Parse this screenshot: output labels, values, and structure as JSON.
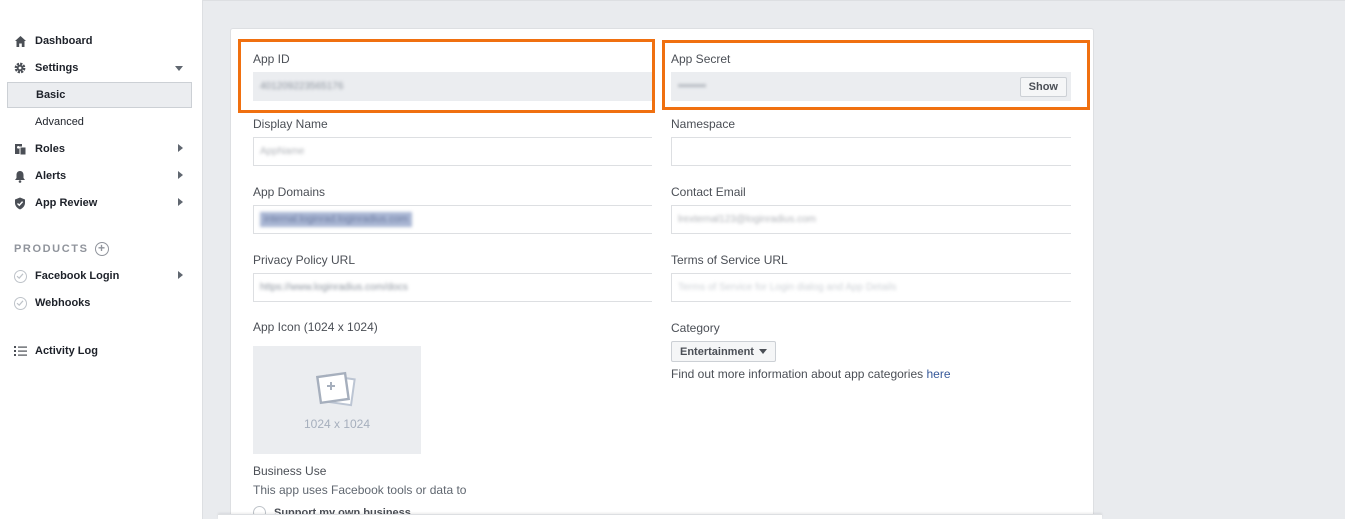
{
  "sidebar": {
    "dashboard": "Dashboard",
    "settings": "Settings",
    "basic": "Basic",
    "advanced": "Advanced",
    "roles": "Roles",
    "alerts": "Alerts",
    "app_review": "App Review",
    "products_heading": "PRODUCTS",
    "facebook_login": "Facebook Login",
    "webhooks": "Webhooks",
    "activity_log": "Activity Log"
  },
  "form": {
    "app_id": {
      "label": "App ID",
      "value": "401209223565176"
    },
    "app_secret": {
      "label": "App Secret",
      "value": "••••••••",
      "show_button": "Show"
    },
    "display_name": {
      "label": "Display Name",
      "value": "AppName"
    },
    "namespace": {
      "label": "Namespace",
      "value": ""
    },
    "app_domains": {
      "label": "App Domains",
      "value": "internal.loginrad.loginradius.com"
    },
    "contact_email": {
      "label": "Contact Email",
      "value": "lrexternal123@loginradius.com"
    },
    "privacy_policy_url": {
      "label": "Privacy Policy URL",
      "value": "https://www.loginradius.com/docs"
    },
    "terms_of_service_url": {
      "label": "Terms of Service URL",
      "placeholder": "Terms of Service for Login dialog and App Details"
    },
    "app_icon": {
      "label": "App Icon (1024 x 1024)",
      "placeholder_text": "1024 x 1024"
    },
    "category": {
      "label": "Category",
      "selected": "Entertainment",
      "help_text": "Find out more information about app categories ",
      "help_link": "here"
    },
    "business_use": {
      "label": "Business Use",
      "description": "This app uses Facebook tools or data to",
      "option_1": "Support my own business"
    }
  },
  "colors": {
    "highlight": "#f07010",
    "link": "#365899"
  }
}
